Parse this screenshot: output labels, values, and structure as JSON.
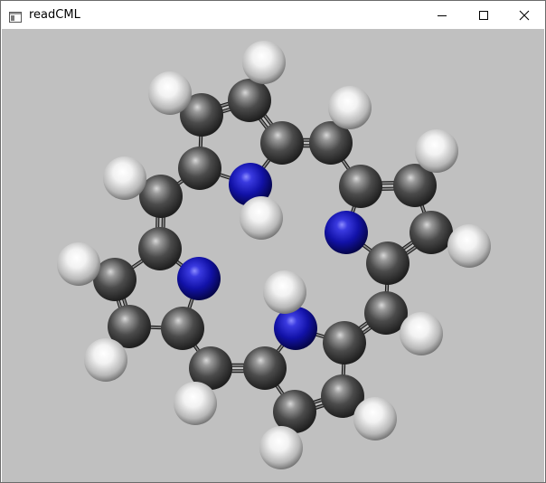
{
  "window": {
    "title": "readCML",
    "icon": "app-window-icon",
    "controls": [
      "minimize-icon",
      "maximize-icon",
      "close-icon"
    ]
  },
  "viewport": {
    "background": "#c0c0c0",
    "atom_colors": {
      "C": "#4a4a4a",
      "N": "#1414b4",
      "H": "#e6e6e6"
    }
  }
}
